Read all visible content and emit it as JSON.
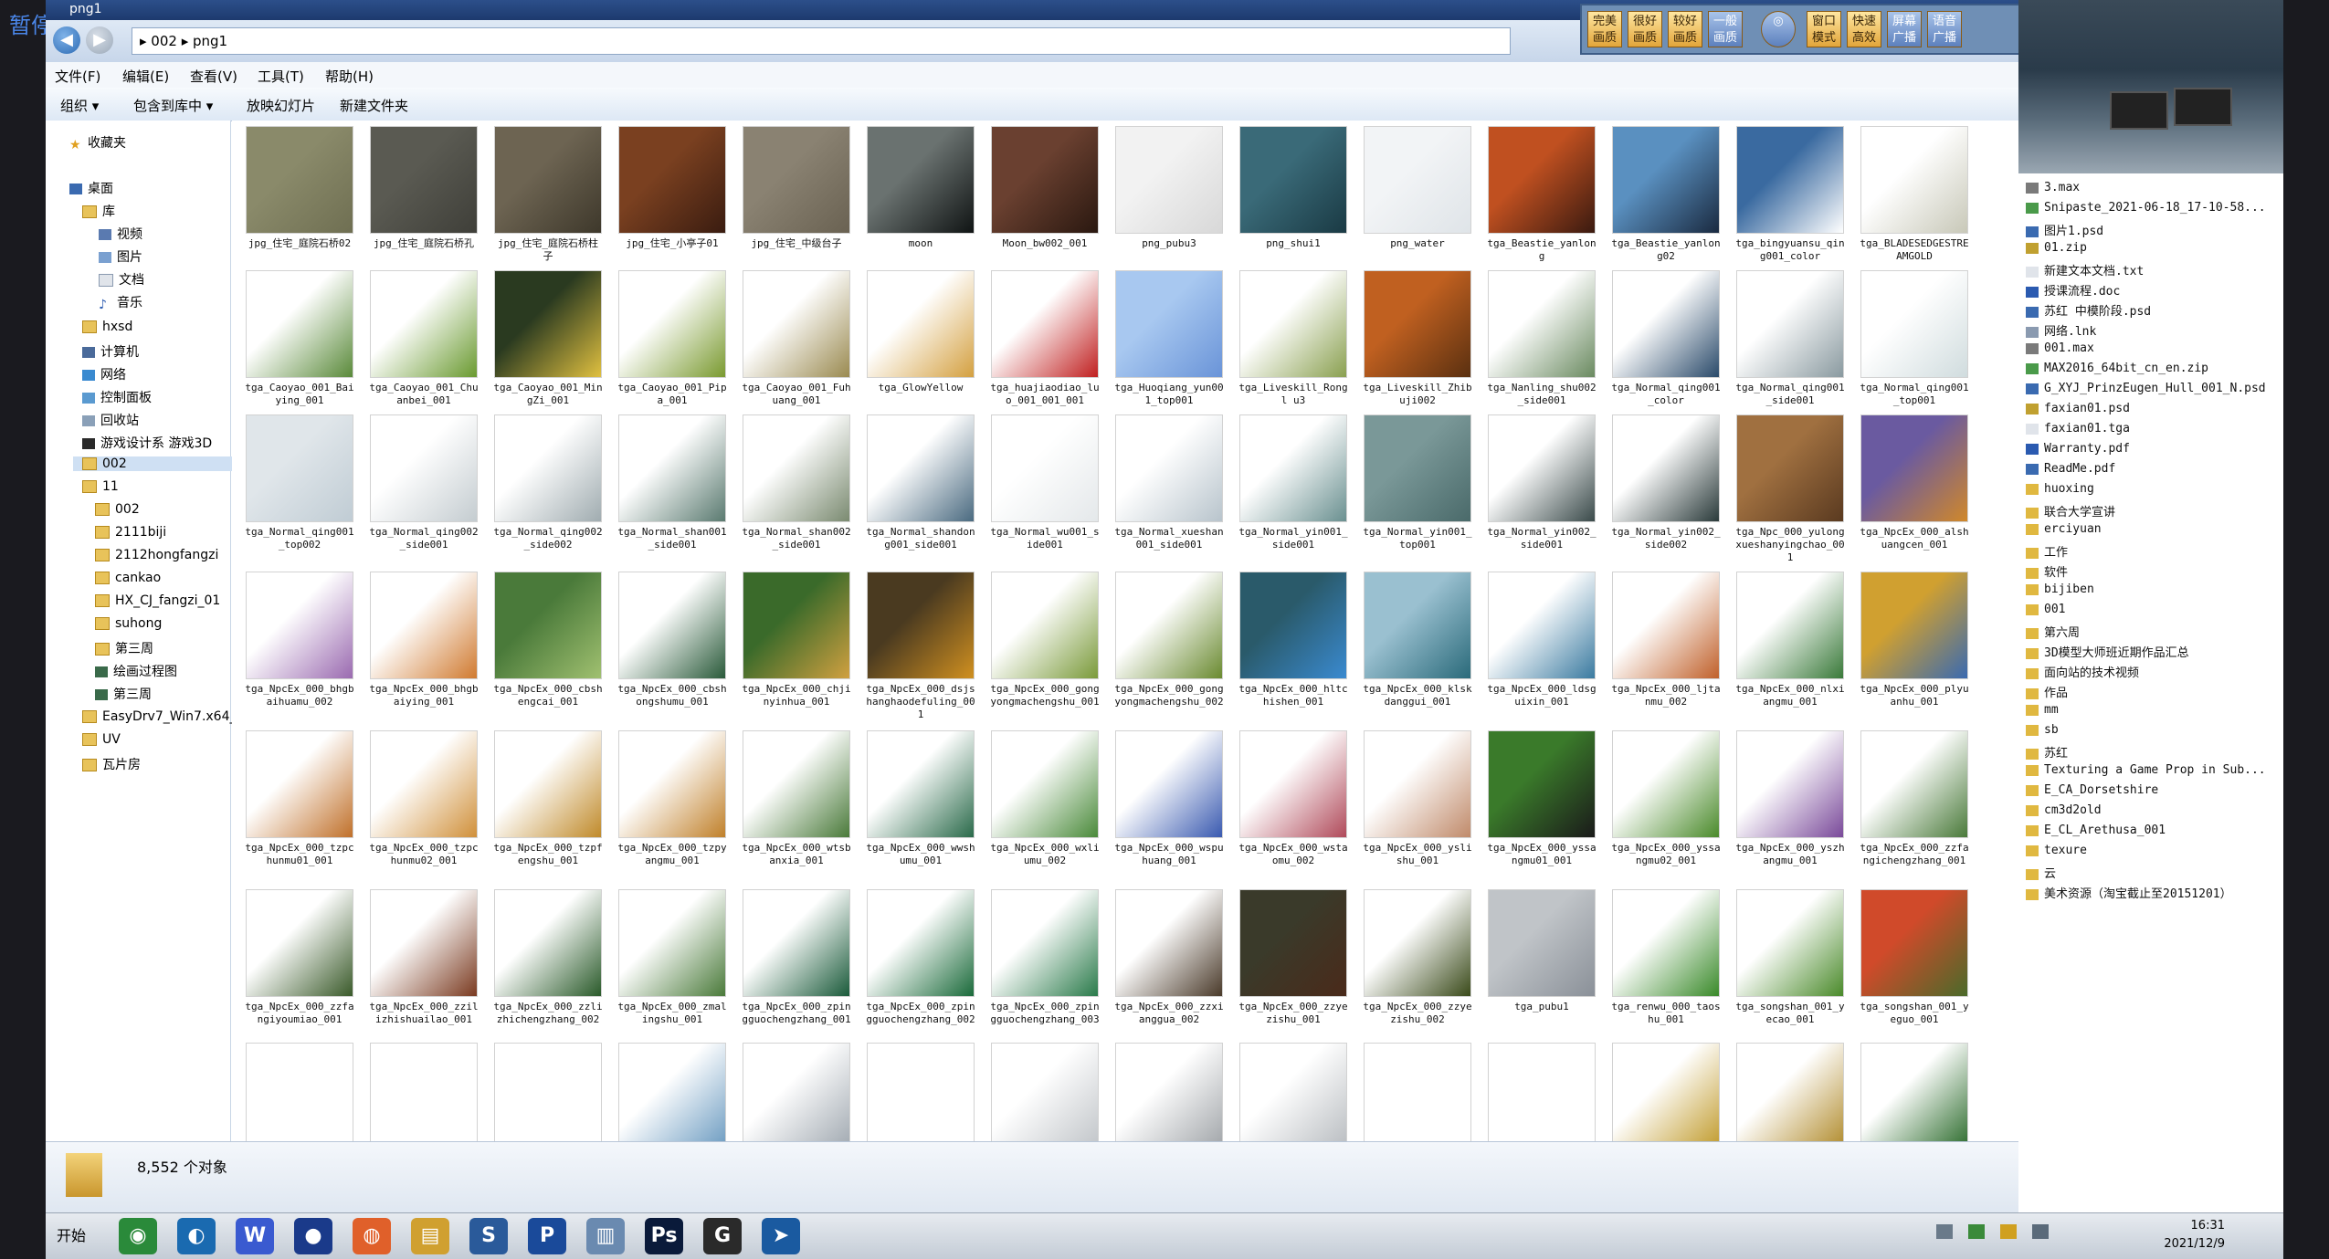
{
  "overlay": {
    "pause_text": "暂停"
  },
  "window": {
    "title": "png1"
  },
  "address": {
    "path": "▸ 002 ▸ png1"
  },
  "menu": [
    "文件(F)",
    "编辑(E)",
    "查看(V)",
    "工具(T)",
    "帮助(H)"
  ],
  "toolbar": [
    "组织 ▾",
    "包含到库中 ▾",
    "放映幻灯片",
    "新建文件夹"
  ],
  "fx_buttons": [
    "完美画质",
    "很好画质",
    "较好画质",
    "一般画质",
    "",
    "窗口模式",
    "快速高效",
    "屏幕广播",
    "语音广播"
  ],
  "nav": {
    "favorites": "收藏夹",
    "desktop": "桌面",
    "library": "库",
    "lib_items": [
      "视频",
      "图片",
      "文档",
      "音乐"
    ],
    "items": [
      "hxsd",
      "计算机",
      "网络",
      "控制面板",
      "回收站",
      "游戏设计系 游戏3D",
      "002",
      "11"
    ],
    "sub_items": [
      "002",
      "2111biji",
      "2112hongfangzi",
      "cankao",
      "HX_CJ_fangzi_01",
      "suhong",
      "第三周",
      "绘画过程图",
      "第三周"
    ],
    "more": [
      "EasyDrv7_Win7.x64_",
      "UV",
      "瓦片房"
    ]
  },
  "files": [
    {
      "name": "jpg_住宅_庭院石桥02",
      "c1": "#8a8a6a",
      "c2": "#6f6f52"
    },
    {
      "name": "jpg_住宅_庭院石桥孔",
      "c1": "#5a5a52",
      "c2": "#3f3f39"
    },
    {
      "name": "jpg_住宅_庭院石桥柱子",
      "c1": "#6d6452",
      "c2": "#3e382b"
    },
    {
      "name": "jpg_住宅_小亭子01",
      "c1": "#7a4020",
      "c2": "#3a1c10"
    },
    {
      "name": "jpg_住宅_中级台子",
      "c1": "#8a8272",
      "c2": "#6a6252"
    },
    {
      "name": "moon",
      "c1": "#6a7270",
      "c2": "#101414"
    },
    {
      "name": "Moon_bw002_001",
      "c1": "#6a4030",
      "c2": "#2a1810"
    },
    {
      "name": "png_pubu3",
      "c1": "#f2f2f2",
      "c2": "#d8d8d8"
    },
    {
      "name": "png_shui1",
      "c1": "#3a6a78",
      "c2": "#1a3a44"
    },
    {
      "name": "png_water",
      "c1": "#f2f4f6",
      "c2": "#dfe4e8"
    },
    {
      "name": "tga_Beastie_yanlong",
      "c1": "#c05020",
      "c2": "#3a1a10"
    },
    {
      "name": "tga_Beastie_yanlong02",
      "c1": "#5a90c0",
      "c2": "#1a2a40"
    },
    {
      "name": "tga_bingyuansu_qing001_color",
      "c1": "#3a6aa0",
      "c2": "#ffffff"
    },
    {
      "name": "tga_BLADESEDGESTREAMGOLD",
      "c1": "#ffffff",
      "c2": "#c8c8b8"
    },
    {
      "name": "tga_Caoyao_001_Baiying_001",
      "c1": "#ffffff",
      "c2": "#5a8a3a"
    },
    {
      "name": "tga_Caoyao_001_Chuanbei_001",
      "c1": "#ffffff",
      "c2": "#6a9a30"
    },
    {
      "name": "tga_Caoyao_001_MingZi_001",
      "c1": "#2a3a20",
      "c2": "#e0c040"
    },
    {
      "name": "tga_Caoyao_001_Pipa_001",
      "c1": "#ffffff",
      "c2": "#7a9a30"
    },
    {
      "name": "tga_Caoyao_001_Fuhuang_001",
      "c1": "#ffffff",
      "c2": "#9a8a50"
    },
    {
      "name": "tga_GlowYellow",
      "c1": "#ffffff",
      "c2": "#d4a040"
    },
    {
      "name": "tga_huajiaodiao_luo_001_001_001",
      "c1": "#ffffff",
      "c2": "#c02020"
    },
    {
      "name": "tga_Huoqiang_yun001_top001",
      "c1": "#a8c8f0",
      "c2": "#6a94d8"
    },
    {
      "name": "tga_Liveskill_Rongl u3",
      "c1": "#ffffff",
      "c2": "#8aa050"
    },
    {
      "name": "tga_Liveskill_Zhibuji002",
      "c1": "#c06020",
      "c2": "#5a3010"
    },
    {
      "name": "tga_Nanling_shu002_side001",
      "c1": "#ffffff",
      "c2": "#6a8a60"
    },
    {
      "name": "tga_Normal_qing001_color",
      "c1": "#ffffff",
      "c2": "#2a4a6a"
    },
    {
      "name": "tga_Normal_qing001_side001",
      "c1": "#ffffff",
      "c2": "#8a9aa0"
    },
    {
      "name": "tga_Normal_qing001_top001",
      "c1": "#ffffff",
      "c2": "#d0dcde"
    },
    {
      "name": "tga_Normal_qing001_top002",
      "c1": "#e0e6ea",
      "c2": "#c0ccd4"
    },
    {
      "name": "tga_Normal_qing002_side001",
      "c1": "#ffffff",
      "c2": "#c4ccd0"
    },
    {
      "name": "tga_Normal_qing002_side002",
      "c1": "#ffffff",
      "c2": "#a0acb0"
    },
    {
      "name": "tga_Normal_shan001_side001",
      "c1": "#ffffff",
      "c2": "#5a7a70"
    },
    {
      "name": "tga_Normal_shan002_side001",
      "c1": "#ffffff",
      "c2": "#7a8a70"
    },
    {
      "name": "tga_Normal_shandong001_side001",
      "c1": "#ffffff",
      "c2": "#4a6a80"
    },
    {
      "name": "tga_Normal_wu001_side001",
      "c1": "#ffffff",
      "c2": "#e4e8ea"
    },
    {
      "name": "tga_Normal_xueshan001_side001",
      "c1": "#ffffff",
      "c2": "#b8c4cc"
    },
    {
      "name": "tga_Normal_yin001_side001",
      "c1": "#ffffff",
      "c2": "#6a9090"
    },
    {
      "name": "tga_Normal_yin001_top001",
      "c1": "#7a9898",
      "c2": "#4a6a6a"
    },
    {
      "name": "tga_Normal_yin002_side001",
      "c1": "#ffffff",
      "c2": "#3a4a4a"
    },
    {
      "name": "tga_Normal_yin002_side002",
      "c1": "#ffffff",
      "c2": "#2a3a3a"
    },
    {
      "name": "tga_Npc_000_yulongxueshanyingchao_001",
      "c1": "#a07040",
      "c2": "#5a3a20"
    },
    {
      "name": "tga_NpcEx_000_alshuangcen_001",
      "c1": "#6a5aa0",
      "c2": "#d0882a"
    },
    {
      "name": "tga_NpcEx_000_bhgbaihuamu_002",
      "c1": "#ffffff",
      "c2": "#9a6ab0"
    },
    {
      "name": "tga_NpcEx_000_bhgbaiying_001",
      "c1": "#ffffff",
      "c2": "#d07a30"
    },
    {
      "name": "tga_NpcEx_000_cbshengcai_001",
      "c1": "#4a7a3a",
      "c2": "#a0c070"
    },
    {
      "name": "tga_NpcEx_000_cbshongshumu_001",
      "c1": "#ffffff",
      "c2": "#2a5a3a"
    },
    {
      "name": "tga_NpcEx_000_chjinyinhua_001",
      "c1": "#3a6a2a",
      "c2": "#d0a040"
    },
    {
      "name": "tga_NpcEx_000_dsjshanghaodefuling_001",
      "c1": "#4a3a20",
      "c2": "#d09020"
    },
    {
      "name": "tga_NpcEx_000_gongyongmachengshu_001",
      "c1": "#ffffff",
      "c2": "#7a9a3a"
    },
    {
      "name": "tga_NpcEx_000_gongyongmachengshu_002",
      "c1": "#ffffff",
      "c2": "#6a8a30"
    },
    {
      "name": "tga_NpcEx_000_hltchishen_001",
      "c1": "#2a5a6a",
      "c2": "#3a8ad0"
    },
    {
      "name": "tga_NpcEx_000_klskdanggui_001",
      "c1": "#9ac0d0",
      "c2": "#2a6a7a"
    },
    {
      "name": "tga_NpcEx_000_ldsguixin_001",
      "c1": "#ffffff",
      "c2": "#3a7aa0"
    },
    {
      "name": "tga_NpcEx_000_ljtanmu_002",
      "c1": "#ffffff",
      "c2": "#c0602a"
    },
    {
      "name": "tga_NpcEx_000_nlxiangmu_001",
      "c1": "#ffffff",
      "c2": "#3a7a3a"
    },
    {
      "name": "tga_NpcEx_000_plyuanhu_001",
      "c1": "#d0a030",
      "c2": "#3a6ab0"
    },
    {
      "name": "tga_NpcEx_000_tzpchunmu01_001",
      "c1": "#ffffff",
      "c2": "#c0702a"
    },
    {
      "name": "tga_NpcEx_000_tzpchunmu02_001",
      "c1": "#ffffff",
      "c2": "#d0903a"
    },
    {
      "name": "tga_NpcEx_000_tzpfengshu_001",
      "c1": "#ffffff",
      "c2": "#c08a2a"
    },
    {
      "name": "tga_NpcEx_000_tzpyangmu_001",
      "c1": "#ffffff",
      "c2": "#c0802a"
    },
    {
      "name": "tga_NpcEx_000_wtsbanxia_001",
      "c1": "#ffffff",
      "c2": "#4a7a3a"
    },
    {
      "name": "tga_NpcEx_000_wwshumu_001",
      "c1": "#ffffff",
      "c2": "#2a6a4a"
    },
    {
      "name": "tga_NpcEx_000_wxliumu_002",
      "c1": "#ffffff",
      "c2": "#4a8a3a"
    },
    {
      "name": "tga_NpcEx_000_wspuhuang_001",
      "c1": "#ffffff",
      "c2": "#3a5ab0"
    },
    {
      "name": "tga_NpcEx_000_wstaomu_002",
      "c1": "#ffffff",
      "c2": "#b04a5a"
    },
    {
      "name": "tga_NpcEx_000_yslishu_001",
      "c1": "#ffffff",
      "c2": "#c08a6a"
    },
    {
      "name": "tga_NpcEx_000_yssangmu01_001",
      "c1": "#3a7a2a",
      "c2": "#1a1a1a"
    },
    {
      "name": "tga_NpcEx_000_yssangmu02_001",
      "c1": "#ffffff",
      "c2": "#4a8a2a"
    },
    {
      "name": "tga_NpcEx_000_yszhangmu_001",
      "c1": "#ffffff",
      "c2": "#7a4a9a"
    },
    {
      "name": "tga_NpcEx_000_zzfangichengzhang_001",
      "c1": "#ffffff",
      "c2": "#4a7a3a"
    },
    {
      "name": "tga_NpcEx_000_zzfangiyoumiao_001",
      "c1": "#ffffff",
      "c2": "#3a5a2a"
    },
    {
      "name": "tga_NpcEx_000_zzilizhishuailao_001",
      "c1": "#ffffff",
      "c2": "#7a3a20"
    },
    {
      "name": "tga_NpcEx_000_zzlizhichengzhang_002",
      "c1": "#ffffff",
      "c2": "#2a5a2a"
    },
    {
      "name": "tga_NpcEx_000_zmalingshu_001",
      "c1": "#ffffff",
      "c2": "#4a7a3a"
    },
    {
      "name": "tga_NpcEx_000_zpingguochengzhang_001",
      "c1": "#ffffff",
      "c2": "#1a5a3a"
    },
    {
      "name": "tga_NpcEx_000_zpingguochengzhang_002",
      "c1": "#ffffff",
      "c2": "#1a6a3a"
    },
    {
      "name": "tga_NpcEx_000_zpingguochengzhang_003",
      "c1": "#ffffff",
      "c2": "#2a7a4a"
    },
    {
      "name": "tga_NpcEx_000_zzxianggua_002",
      "c1": "#ffffff",
      "c2": "#4a3a2a"
    },
    {
      "name": "tga_NpcEx_000_zzyezishu_001",
      "c1": "#3a3a2a",
      "c2": "#4a2a1a"
    },
    {
      "name": "tga_NpcEx_000_zzyezishu_002",
      "c1": "#ffffff",
      "c2": "#3a4a1a"
    },
    {
      "name": "tga_pubu1",
      "c1": "#c0c4c8",
      "c2": "#8a9098"
    },
    {
      "name": "tga_renwu_000_taoshu_001",
      "c1": "#ffffff",
      "c2": "#3a8a2a"
    },
    {
      "name": "tga_songshan_001_yecao_001",
      "c1": "#ffffff",
      "c2": "#4a8a2a"
    },
    {
      "name": "tga_songshan_001_yeguo_001",
      "c1": "#d04a2a",
      "c2": "#4a6a2a"
    },
    {
      "name": "",
      "c1": "#ffffff",
      "c2": "#ffffff"
    },
    {
      "name": "",
      "c1": "#ffffff",
      "c2": "#ffffff"
    },
    {
      "name": "",
      "c1": "#ffffff",
      "c2": "#ffffff"
    },
    {
      "name": "",
      "c1": "#ffffff",
      "c2": "#6a9ac0"
    },
    {
      "name": "",
      "c1": "#ffffff",
      "c2": "#a0a8b0"
    },
    {
      "name": "",
      "c1": "#ffffff",
      "c2": "#ffffff"
    },
    {
      "name": "",
      "c1": "#ffffff",
      "c2": "#c0c4c8"
    },
    {
      "name": "",
      "c1": "#ffffff",
      "c2": "#a0a4a8"
    },
    {
      "name": "",
      "c1": "#ffffff",
      "c2": "#b8bcc0"
    },
    {
      "name": "",
      "c1": "#ffffff",
      "c2": "#ffffff"
    },
    {
      "name": "",
      "c1": "#ffffff",
      "c2": "#ffffff"
    },
    {
      "name": "",
      "c1": "#ffffff",
      "c2": "#c09a2a"
    },
    {
      "name": "",
      "c1": "#ffffff",
      "c2": "#b08a2a"
    },
    {
      "name": "",
      "c1": "#ffffff",
      "c2": "#2a6a2a"
    },
    {
      "name": "",
      "c1": "#ffffff",
      "c2": "#3a7a3a"
    }
  ],
  "status": {
    "count": "8,552 个对象"
  },
  "desktop_files": [
    "3.max",
    "Snipaste_2021-06-18_17-10-58...",
    "图片1.psd",
    "01.zip",
    "新建文本文档.txt",
    "授课流程.doc",
    "苏红 中模阶段.psd",
    "网络.lnk",
    "001.max",
    "MAX2016_64bit_cn_en.zip",
    "G_XYJ_PrinzEugen_Hull_001_N.psd",
    "faxian01.psd",
    "faxian01.tga",
    "Warranty.pdf",
    "ReadMe.pdf",
    "huoxing",
    "联合大学宣讲",
    "erciyuan",
    "工作",
    "软件",
    "bijiben",
    "001",
    "第六周",
    "3D模型大师班近期作品汇总",
    "面向站的技术视频",
    "作品",
    "mm",
    "sb",
    "苏红",
    "Texturing a Game Prop in Sub...",
    "E_CA_Dorsetshire",
    "cm3d2old",
    "E_CL_Arethusa_001",
    "texure",
    "云",
    "美术资源（淘宝截止至20151201）"
  ],
  "taskbar": {
    "start": "开始",
    "apps": [
      {
        "name": "chrome-icon",
        "glyph": "◉",
        "color": "#2a8a3a"
      },
      {
        "name": "qq-icon",
        "glyph": "◐",
        "color": "#1a6ab0"
      },
      {
        "name": "wps-icon",
        "glyph": "W",
        "color": "#3a5ad0"
      },
      {
        "name": "globe-icon",
        "glyph": "●",
        "color": "#1a3a8a"
      },
      {
        "name": "firefox-icon",
        "glyph": "◍",
        "color": "#e0602a"
      },
      {
        "name": "explorer-icon",
        "glyph": "▤",
        "color": "#d0a030"
      },
      {
        "name": "app-s-icon",
        "glyph": "S",
        "color": "#2a5a9a"
      },
      {
        "name": "app-p-icon",
        "glyph": "P",
        "color": "#1a4a9a"
      },
      {
        "name": "app-book-icon",
        "glyph": "▥",
        "color": "#6a8ab0"
      },
      {
        "name": "photoshop-icon",
        "glyph": "Ps",
        "color": "#0a1a3a"
      },
      {
        "name": "app-g-icon",
        "glyph": "G",
        "color": "#2a2a2a"
      },
      {
        "name": "app-share-icon",
        "glyph": "➤",
        "color": "#1a5aa0"
      }
    ],
    "time": "16:31",
    "date": "2021/12/9"
  }
}
